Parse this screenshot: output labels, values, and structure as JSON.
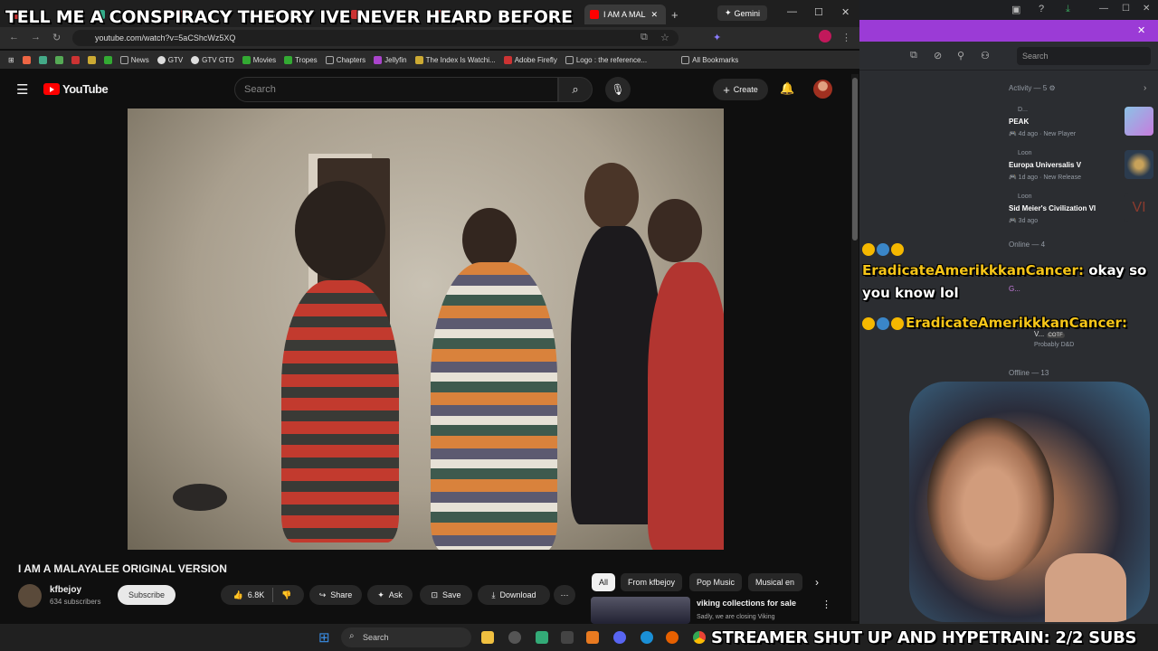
{
  "overlay": {
    "top_text": "TELL ME A CONSPIRACY THEORY IVE NEVER HEARD BEFORE",
    "bottom_text": "STREAMER SHUT UP AND HYPETRAIN: 2/2 SUBS"
  },
  "browser": {
    "active_tab": "I AM A MAL",
    "gemini_label": "Gemini",
    "url": "youtube.com/watch?v=5aCShcWz5XQ",
    "bookmarks": [
      "News",
      "GTV",
      "GTV GTD",
      "Movies",
      "Tropes",
      "Chapters",
      "Jellyfin",
      "The Index Is Watchi...",
      "Adobe Firefly",
      "Logo : the reference...",
      "All Bookmarks"
    ]
  },
  "youtube": {
    "logo": "YouTube",
    "search_placeholder": "Search",
    "create_label": "Create",
    "video_title": "I AM A MALAYALEE ORIGINAL VERSION",
    "channel_name": "kfbejoy",
    "channel_subs": "634 subscribers",
    "subscribe_label": "Subscribe",
    "likes": "6.8K",
    "share_label": "Share",
    "ask_label": "Ask",
    "save_label": "Save",
    "download_label": "Download",
    "chips": [
      "All",
      "From kfbejoy",
      "Pop Music",
      "Musical en"
    ],
    "rec_title": "viking collections for sale",
    "rec_sub": "Sadly, we are closing Viking"
  },
  "discord": {
    "search_placeholder": "Search",
    "activity_header": "Activity — 5",
    "activities": [
      {
        "user": "D...",
        "game": "PEAK",
        "meta": "4d ago",
        "tag": "New Player"
      },
      {
        "user": "Loon",
        "game": "Europa Universalis V",
        "meta": "1d ago",
        "tag": "New Release"
      },
      {
        "user": "Loon",
        "game": "Sid Meier's Civilization VI",
        "meta": "3d ago",
        "tag": ""
      }
    ],
    "online_header": "Online — 4",
    "online_users": [
      "G...",
      "V..."
    ],
    "online_sub": "Probably D&D",
    "cotf": "COTF",
    "offline_header": "Offline — 13"
  },
  "chat": [
    {
      "name": "EradicateAmerikkkanCancer:",
      "msg": "okay so"
    },
    {
      "name": "",
      "msg": "you know lol"
    },
    {
      "name": "EradicateAmerikkkanCancer:",
      "msg": ""
    }
  ],
  "taskbar": {
    "search_placeholder": "Search"
  }
}
